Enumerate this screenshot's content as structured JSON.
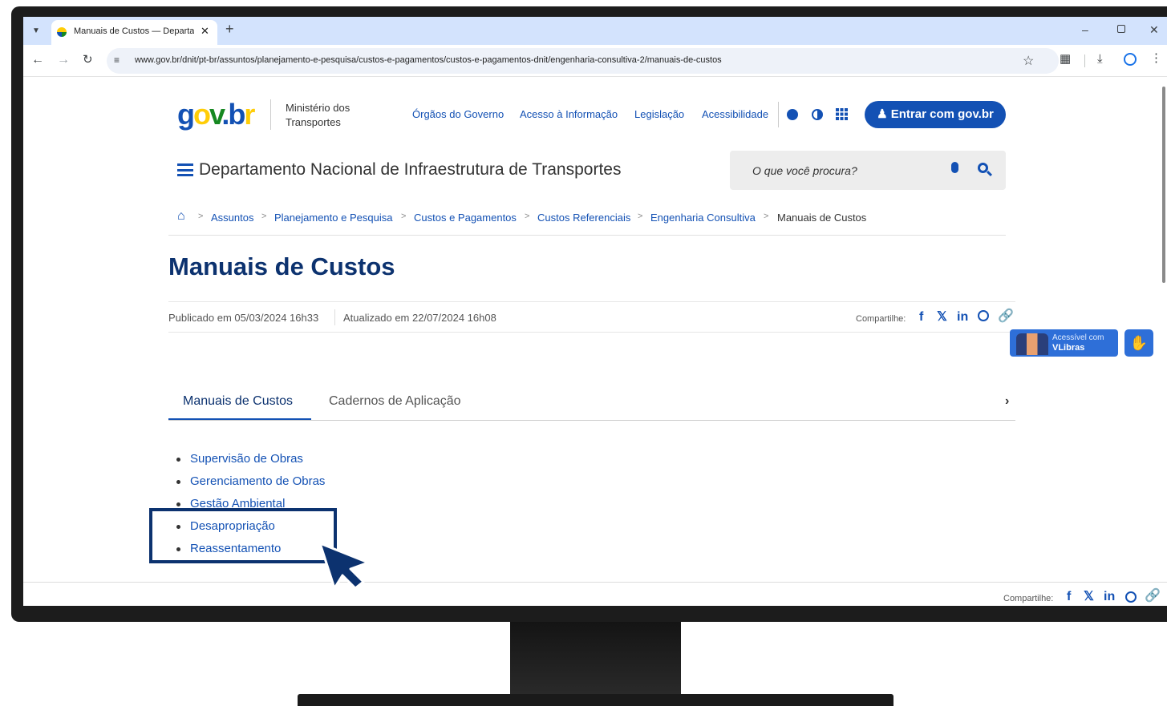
{
  "browser": {
    "tab_title": "Manuais de Custos — Departan",
    "url": "www.gov.br/dnit/pt-br/assuntos/planejamento-e-pesquisa/custos-e-pagamentos/custos-e-pagamentos-dnit/engenharia-consultiva-2/manuais-de-custos"
  },
  "header": {
    "logo": "gov.br",
    "ministry": "Ministério dos Transportes",
    "links": [
      "Órgãos do Governo",
      "Acesso à Informação",
      "Legislação",
      "Acessibilidade"
    ],
    "login_label": "Entrar com gov.br"
  },
  "site": {
    "title": "Departamento Nacional de Infraestrutura de Transportes",
    "search_placeholder": "O que você procura?"
  },
  "breadcrumb": [
    "Assuntos",
    "Planejamento e Pesquisa",
    "Custos e Pagamentos",
    "Custos Referenciais",
    "Engenharia Consultiva",
    "Manuais de Custos"
  ],
  "main": {
    "title": "Manuais de Custos",
    "published": "Publicado em 05/03/2024 16h33",
    "updated": "Atualizado em 22/07/2024 16h08",
    "share_label": "Compartilhe:",
    "tabs": [
      "Manuais de Custos",
      "Cadernos de Aplicação"
    ],
    "items": [
      "Supervisão de Obras",
      "Gerenciamento de Obras",
      "Gestão Ambiental",
      "Desapropriação",
      "Reassentamento"
    ]
  },
  "vlibras": {
    "line1": "Acessível com",
    "line2": "VLibras"
  },
  "footer": {
    "share_label": "Compartilhe:"
  },
  "colors": {
    "brand_blue": "#1351b4",
    "title_blue": "#0c326f",
    "highlight_box": "#0c326f",
    "tab_bar": "#d3e3fd"
  }
}
